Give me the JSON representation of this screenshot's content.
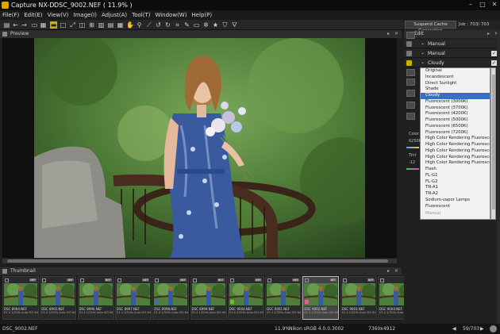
{
  "window": {
    "app_title": "Capture NX-D",
    "file_title": "DSC_9002.NEF ( 11.9% )"
  },
  "menu": [
    "File(F)",
    "Edit(E)",
    "View(V)",
    "Image(I)",
    "Adjust(A)",
    "Tool(T)",
    "Window(W)",
    "Help(P)"
  ],
  "panels": {
    "preview": "Preview",
    "thumbnail": "Thumbnail",
    "edit": "Edit"
  },
  "right_header": {
    "cache_button": "Suspend Cache Generation",
    "job_count": "Job : 703/ 703"
  },
  "edit_rows": [
    {
      "label": "Manual",
      "checked": true
    },
    {
      "label": "Manual",
      "checked": true
    },
    {
      "label": "Cloudy",
      "checked": true
    }
  ],
  "wb_dropdown": {
    "options": [
      "Original",
      "Incandescent",
      "Direct Sunlight",
      "Shade",
      "Cloudy",
      "Fluorescent (3000K)",
      "Fluorescent (3700K)",
      "Fluorescent (4200K)",
      "Fluorescent (5000K)",
      "Fluorescent (6500K)",
      "Fluorescent (7200K)",
      "High Color Rendering Fluorescen...",
      "High Color Rendering Fluorescen...",
      "High Color Rendering Fluorescen...",
      "High Color Rendering Fluorescen...",
      "High Color Rendering Fluorescen...",
      "Flash",
      "FL-G1",
      "FL-G2",
      "TN-A1",
      "TN-A2",
      "Sodium-vapor Lamps",
      "Fluorescent",
      "Manual"
    ],
    "selected": "Cloudy",
    "disabled": [
      "Manual"
    ]
  },
  "side_labels": {
    "color_temp": "Color",
    "color_val": "6250K",
    "tint": "Tint",
    "tint_val": "-12"
  },
  "thumbnails": [
    {
      "file": "DSC 8994.NEF",
      "meta": "f/1.4 1/320s Auto ISO 64",
      "badge": "NEF",
      "label_color": "",
      "selected": false
    },
    {
      "file": "DSC 8995.NEF",
      "meta": "f/1.4 1/320s Auto ISO 64",
      "badge": "NEF",
      "label_color": "",
      "selected": false
    },
    {
      "file": "DSC 8996.NEF",
      "meta": "f/1.4 1/320s Auto ISO 64",
      "badge": "NEF",
      "label_color": "",
      "selected": false
    },
    {
      "file": "DSC 8997.NEF",
      "meta": "f/1.4 1/320s Auto ISO 64",
      "badge": "NEF",
      "label_color": "",
      "selected": false
    },
    {
      "file": "DSC 8998.NEF",
      "meta": "f/1.4 1/320s Auto ISO 64",
      "badge": "NEF",
      "label_color": "#3a6fc4",
      "selected": false
    },
    {
      "file": "DSC 8999.NEF",
      "meta": "f/1.4 1/320s Auto ISO 64",
      "badge": "NEF",
      "label_color": "",
      "selected": false
    },
    {
      "file": "DSC 9000.NEF",
      "meta": "f/1.4 1/320s Auto ISO 64",
      "badge": "NEF",
      "label_color": "#6cbf3a",
      "selected": false
    },
    {
      "file": "DSC 9001.NEF",
      "meta": "f/1.4 1/320s Auto ISO 64",
      "badge": "NEF",
      "label_color": "",
      "selected": false
    },
    {
      "file": "DSC 9002.NEF",
      "meta": "f/1.4 1/320s Auto ISO 64",
      "badge": "NEF",
      "label_color": "#e0609a",
      "selected": true
    },
    {
      "file": "DSC 9003.NEF",
      "meta": "f/1.4 1/320s Auto ISO 64",
      "badge": "NEF",
      "label_color": "",
      "selected": false
    },
    {
      "file": "DSC 9004.NEF",
      "meta": "f/1.4 1/320s Auto ISO 64",
      "badge": "NEF",
      "label_color": "",
      "selected": false
    }
  ],
  "status": {
    "filename": "DSC_9002.NEF",
    "zoom": "11.9%",
    "profile": "Nikon sRGB 4.0.0.3002",
    "dimensions": "7360x4912",
    "pager": "59/703"
  },
  "colors": {
    "accent": "#3a6fc4",
    "bg": "#1e1e1e"
  }
}
